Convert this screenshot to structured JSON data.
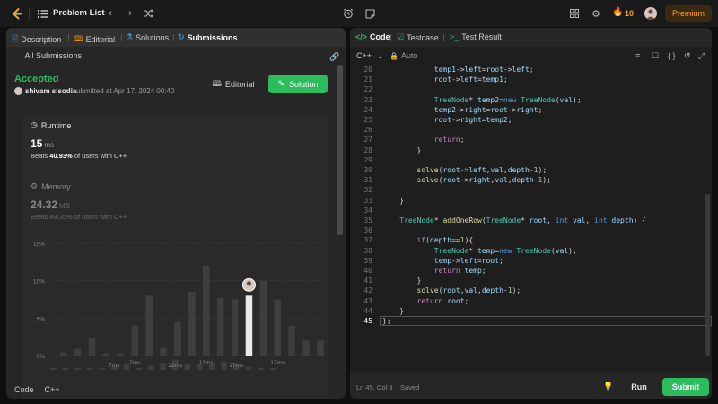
{
  "topbar": {
    "problem_list_label": "Problem List",
    "streak_count": "10",
    "premium_label": "Premium"
  },
  "left_tabs": [
    {
      "label": "Description"
    },
    {
      "label": "Editorial"
    },
    {
      "label": "Solutions"
    },
    {
      "label": "Submissions"
    }
  ],
  "submission": {
    "back_label": "All Submissions",
    "status": "Accepted",
    "username": "shivam sisodia",
    "submitted_at": "submitted at Apr 17, 2024 00:40",
    "editorial_btn": "Editorial",
    "solution_btn": "Solution",
    "runtime": {
      "title": "Runtime",
      "value": "15",
      "unit": "ms",
      "beats_prefix": "Beats",
      "beats_pct": "40.93%",
      "beats_suffix": "of users with C++"
    },
    "memory": {
      "title": "Memory",
      "value": "24.32",
      "unit": "MB",
      "beats_text": "Beats 49.35% of users with C++"
    },
    "code_label": "Code",
    "code_lang": "C++"
  },
  "chart_data": {
    "type": "bar",
    "x_ticks": [
      "7ms",
      "12ms",
      "17ms"
    ],
    "y_ticks": [
      "15%",
      "10%",
      "5%",
      "0%"
    ],
    "ylim": [
      0,
      15
    ],
    "values": [
      0.4,
      0.9,
      2.4,
      0.3,
      0.3,
      4,
      8,
      1,
      4.5,
      8.5,
      12,
      7.7,
      7.5,
      8,
      10,
      7.5,
      4,
      2,
      2
    ],
    "highlight_index": 13
  },
  "right_tabs": [
    {
      "label": "Code"
    },
    {
      "label": "Testcase"
    },
    {
      "label": "Test Result"
    }
  ],
  "editor": {
    "language": "C++",
    "auto_label": "Auto",
    "status": "Ln 45, Col 3",
    "saved": "Saved",
    "run_label": "Run",
    "submit_label": "Submit",
    "lines": [
      {
        "n": "20",
        "t": "            temp1->left=root->left;"
      },
      {
        "n": "21",
        "t": "            root->left=temp1;"
      },
      {
        "n": "22",
        "t": ""
      },
      {
        "n": "23",
        "t": "            TreeNode* temp2=new TreeNode(val);"
      },
      {
        "n": "24",
        "t": "            temp2->right=root->right;"
      },
      {
        "n": "25",
        "t": "            root->right=temp2;"
      },
      {
        "n": "26",
        "t": ""
      },
      {
        "n": "27",
        "t": "            return;"
      },
      {
        "n": "28",
        "t": "        }"
      },
      {
        "n": "29",
        "t": ""
      },
      {
        "n": "30",
        "t": "        solve(root->left,val,depth-1);"
      },
      {
        "n": "31",
        "t": "        solve(root->right,val,depth-1);"
      },
      {
        "n": "32",
        "t": ""
      },
      {
        "n": "33",
        "t": "    }"
      },
      {
        "n": "34",
        "t": ""
      },
      {
        "n": "35",
        "t": "    TreeNode* addOneRow(TreeNode* root, int val, int depth) {"
      },
      {
        "n": "36",
        "t": ""
      },
      {
        "n": "37",
        "t": "        if(depth==1){"
      },
      {
        "n": "38",
        "t": "            TreeNode* temp=new TreeNode(val);"
      },
      {
        "n": "39",
        "t": "            temp->left=root;"
      },
      {
        "n": "40",
        "t": "            return temp;"
      },
      {
        "n": "41",
        "t": "        }"
      },
      {
        "n": "42",
        "t": "        solve(root,val,depth-1);"
      },
      {
        "n": "43",
        "t": "        return root;"
      },
      {
        "n": "44",
        "t": "    }"
      },
      {
        "n": "45",
        "t": "};"
      }
    ],
    "current_line": "45"
  },
  "colors": {
    "accent_green": "#2cbb5d",
    "brand_orange": "#ffa116",
    "bar_default": "#3e3e3e",
    "bar_highlight": "#eaeaea"
  }
}
